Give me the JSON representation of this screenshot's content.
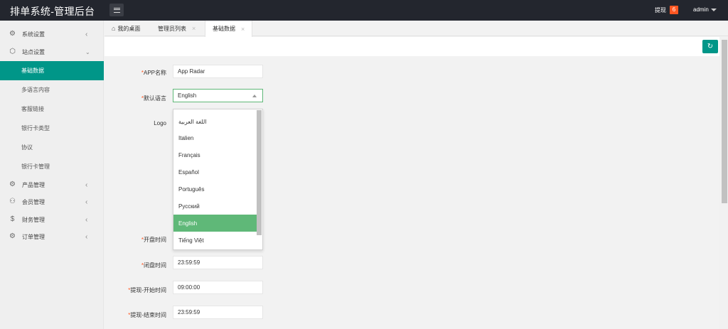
{
  "header": {
    "title": "排单系统-管理后台",
    "withdraw_label": "提现",
    "withdraw_count": "6",
    "user": "admin"
  },
  "sidebar": {
    "items": [
      {
        "label": "系统设置",
        "icon": "gear-icon"
      },
      {
        "label": "站点设置",
        "icon": "site-icon"
      },
      {
        "label": "产品管理",
        "icon": "product-icon"
      },
      {
        "label": "会员管理",
        "icon": "user-icon"
      },
      {
        "label": "财务管理",
        "icon": "dollar-icon"
      },
      {
        "label": "订单管理",
        "icon": "order-icon"
      }
    ],
    "subitems": [
      "基础数据",
      "多语言内容",
      "客服链接",
      "银行卡类型",
      "协议",
      "银行卡管理"
    ]
  },
  "tabs": [
    {
      "label": "我的桌面"
    },
    {
      "label": "管理员列表"
    },
    {
      "label": "基础数据"
    }
  ],
  "form": {
    "app_name_label": "APP名称",
    "app_name_value": "App Radar",
    "language_label": "默认语言",
    "language_value": "English",
    "logo_label": "Logo",
    "open_time_label": "开盘时间",
    "close_time_label": "闭盘时间",
    "close_time_value": "23:59:59",
    "withdraw_start_label": "提现-开始时间",
    "withdraw_start_value": "09:00:00",
    "withdraw_end_label": "提现-结束时间",
    "withdraw_end_value": "23:59:59"
  },
  "dropdown": {
    "options": [
      "اللغة العربية",
      "Italien",
      "Français",
      "Español",
      "Português",
      "Русский",
      "English",
      "Tiếng Việt"
    ],
    "selected": "English"
  },
  "colors": {
    "accent": "#009688",
    "selected": "#5FB878",
    "header_bg": "#23262e",
    "badge": "#ff5722"
  }
}
